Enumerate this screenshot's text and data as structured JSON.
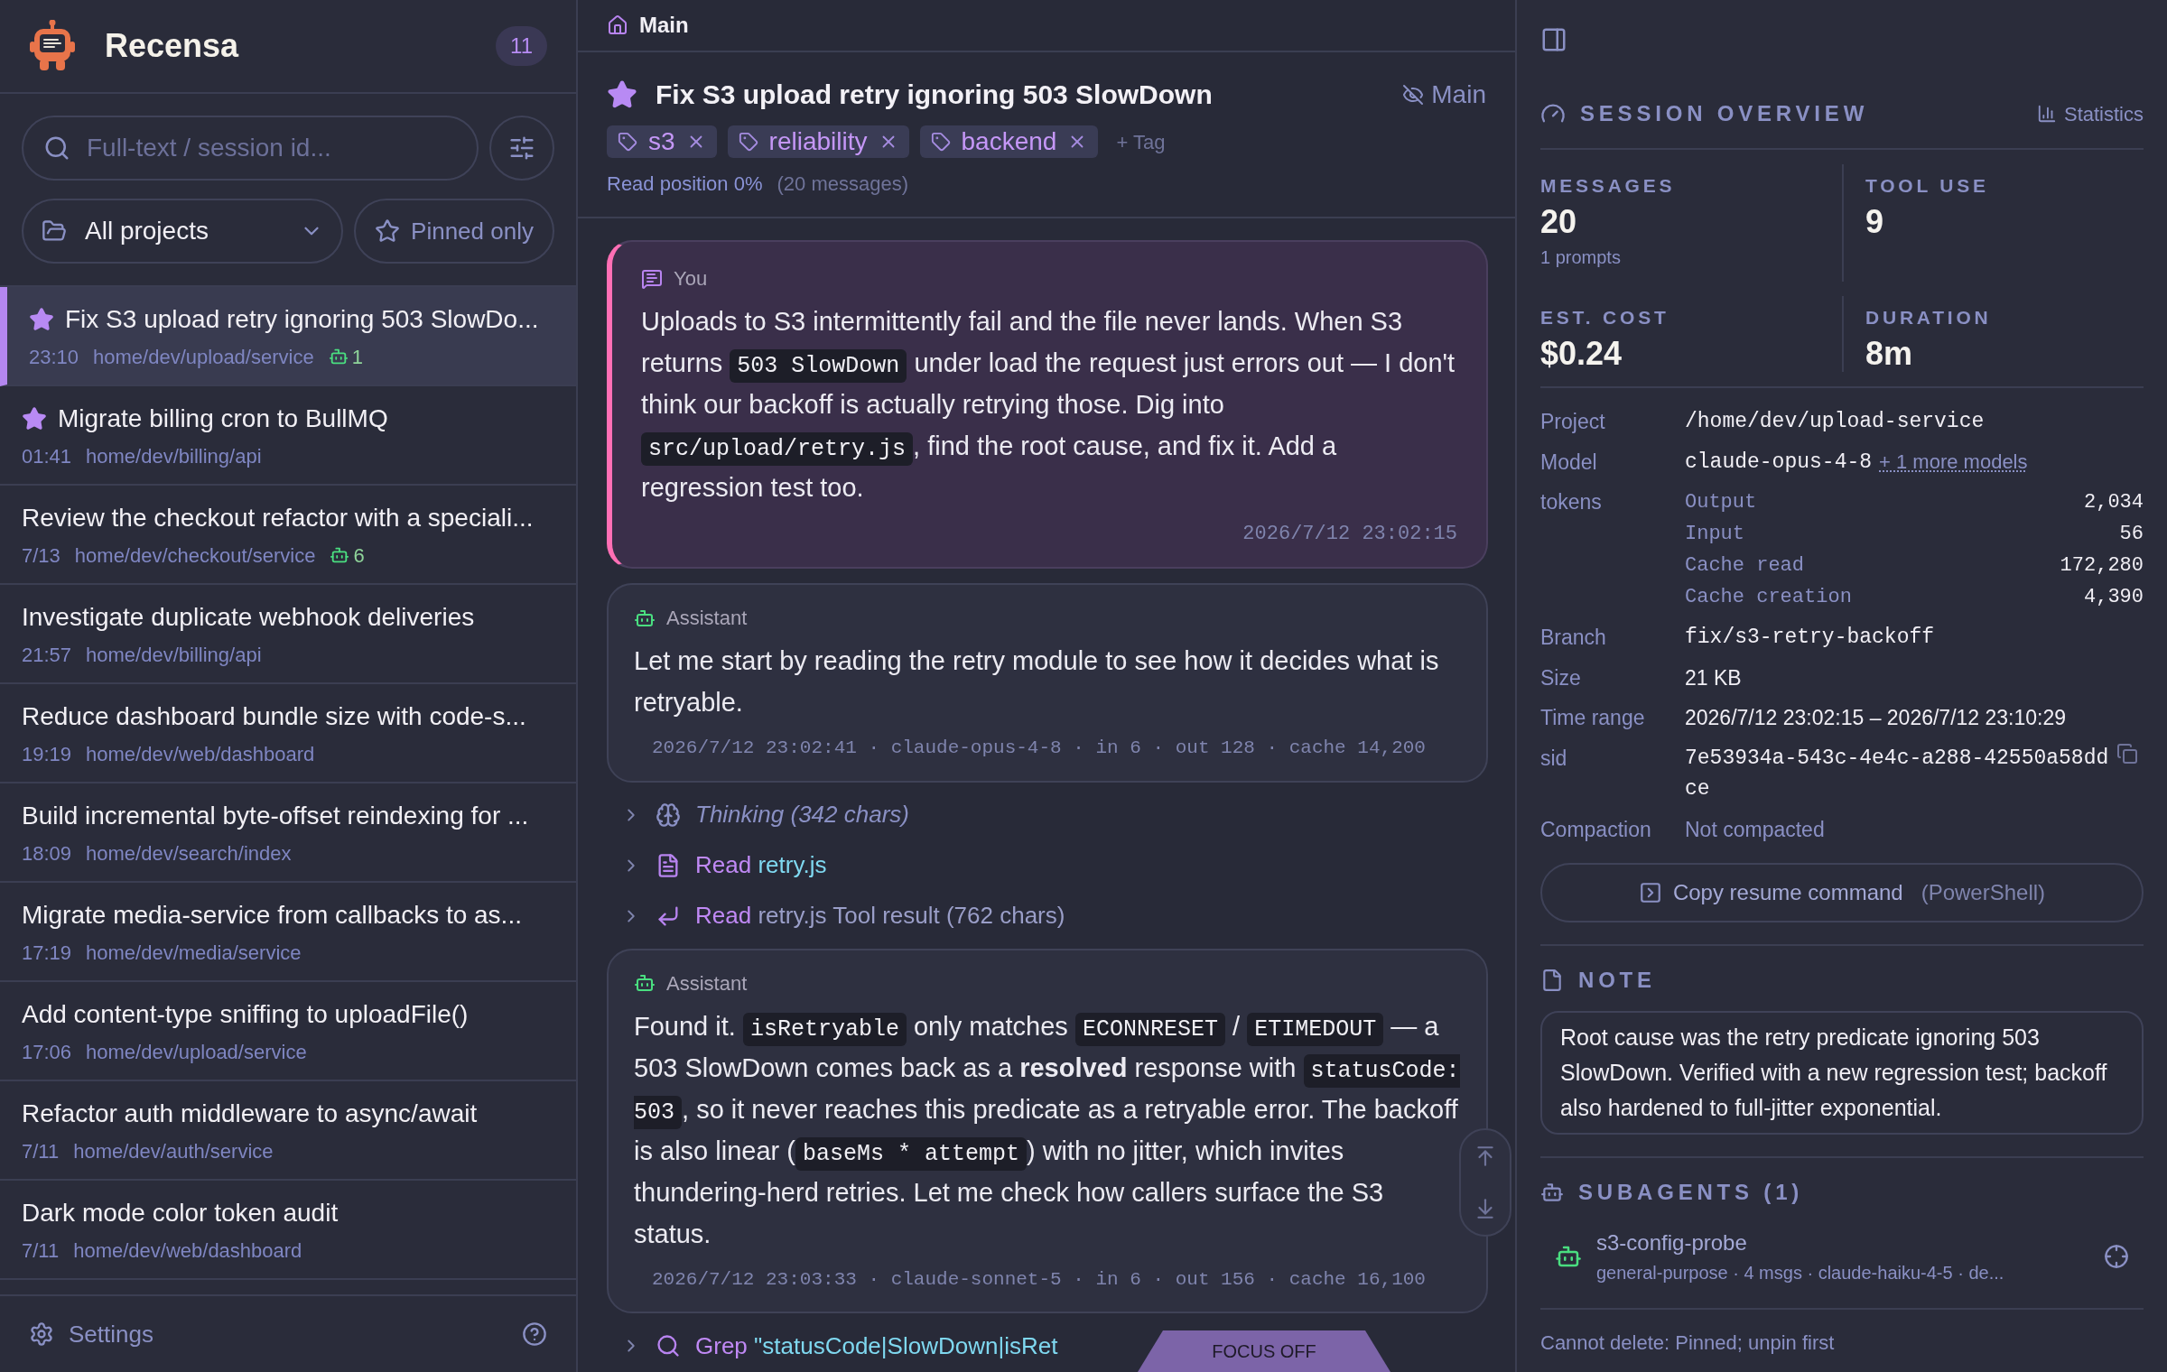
{
  "app": {
    "name": "Recensa",
    "count": "11"
  },
  "search": {
    "placeholder": "Full-text / session id..."
  },
  "project_filter": {
    "value": "All projects"
  },
  "pinned_filter": {
    "label": "Pinned only"
  },
  "sessions": [
    {
      "title": "Fix S3 upload retry ignoring 503 SlowDo...",
      "time": "23:10",
      "path": "home/dev/upload/service",
      "subagents": "1",
      "pinned": true,
      "selected": true
    },
    {
      "title": "Migrate billing cron to BullMQ",
      "time": "01:41",
      "path": "home/dev/billing/api",
      "pinned": true,
      "selected": false
    },
    {
      "title": "Review the checkout refactor with a speciali...",
      "time": "7/13",
      "path": "home/dev/checkout/service",
      "subagents": "6",
      "pinned": false,
      "selected": false
    },
    {
      "title": "Investigate duplicate webhook deliveries",
      "time": "21:57",
      "path": "home/dev/billing/api",
      "pinned": false,
      "selected": false
    },
    {
      "title": "Reduce dashboard bundle size with code-s...",
      "time": "19:19",
      "path": "home/dev/web/dashboard",
      "pinned": false,
      "selected": false
    },
    {
      "title": "Build incremental byte-offset reindexing for ...",
      "time": "18:09",
      "path": "home/dev/search/index",
      "pinned": false,
      "selected": false
    },
    {
      "title": "Migrate media-service from callbacks to as...",
      "time": "17:19",
      "path": "home/dev/media/service",
      "pinned": false,
      "selected": false
    },
    {
      "title": "Add content-type sniffing to uploadFile()",
      "time": "17:06",
      "path": "home/dev/upload/service",
      "pinned": false,
      "selected": false
    },
    {
      "title": "Refactor auth middleware to async/await",
      "time": "7/11",
      "path": "home/dev/auth/service",
      "pinned": false,
      "selected": false
    },
    {
      "title": "Dark mode color token audit",
      "time": "7/11",
      "path": "home/dev/web/dashboard",
      "pinned": false,
      "selected": false
    }
  ],
  "settings": {
    "label": "Settings"
  },
  "breadcrumb": "Main",
  "session": {
    "title": "Fix S3 upload retry ignoring 503 SlowDown",
    "pinned": true,
    "branch": "Main",
    "tags": [
      "s3",
      "reliability",
      "backend"
    ],
    "add_tag": "+ Tag",
    "read_position": "Read position",
    "read_percent": "0%",
    "message_count": "(20 messages)"
  },
  "messages": [
    {
      "kind": "user",
      "author": "You",
      "parts": [
        {
          "kind": "text",
          "text": "Uploads to S3 intermittently fail and the file never lands. When S3 returns "
        },
        {
          "kind": "code",
          "text": "503 SlowDown"
        },
        {
          "kind": "text",
          "text": " under load the request just errors out — I don't think our backoff is actually retrying those. Dig into "
        },
        {
          "kind": "code",
          "text": "src/upload/retry.js"
        },
        {
          "kind": "text",
          "text": ", find the root cause, and fix it. Add a regression test too."
        }
      ],
      "footer": "2026/7/12 23:02:15"
    },
    {
      "kind": "assistant",
      "author": "Assistant",
      "parts": [
        {
          "kind": "text",
          "text": "Let me start by reading the retry module to see how it decides what is retryable."
        }
      ],
      "footer": "2026/7/12 23:02:41 · claude-opus-4-8 · in 6 · out 128 · cache 14,200"
    },
    {
      "kind": "thinking",
      "label": "Thinking (342 chars)"
    },
    {
      "kind": "read",
      "verb": "Read",
      "target": "retry.js"
    },
    {
      "kind": "result",
      "verb": "Read",
      "target": "retry.js Tool result (762 chars)"
    },
    {
      "kind": "assistant",
      "author": "Assistant",
      "parts": [
        {
          "kind": "text",
          "text": "Found it. "
        },
        {
          "kind": "code",
          "text": "isRetryable"
        },
        {
          "kind": "text",
          "text": " only matches "
        },
        {
          "kind": "code",
          "text": "ECONNRESET"
        },
        {
          "kind": "text",
          "text": " / "
        },
        {
          "kind": "code",
          "text": "ETIMEDOUT"
        },
        {
          "kind": "text",
          "text": " — a 503 SlowDown comes back as a **resolved** response with "
        },
        {
          "kind": "code",
          "text": "statusCode: 503"
        },
        {
          "kind": "text",
          "text": ", so it never reaches this predicate as a retryable error. The backoff is also linear ("
        },
        {
          "kind": "code",
          "text": "baseMs * attempt"
        },
        {
          "kind": "text",
          "text": ") with no jitter, which invites thundering-herd retries. Let me check how callers surface the S3 status."
        }
      ],
      "footer": "2026/7/12 23:03:33 · claude-sonnet-5 · in 6 · out 156 · cache 16,100"
    },
    {
      "kind": "grep",
      "verb": "Grep",
      "target": "\"statusCode|SlowDown|isRet"
    }
  ],
  "focus_toggle": "FOCUS OFF",
  "overview": {
    "title": "SESSION OVERVIEW",
    "stats_link": "Statistics",
    "stats": [
      {
        "label": "MESSAGES",
        "value": "20",
        "sub": "1 prompts"
      },
      {
        "label": "TOOL USE",
        "value": "9"
      },
      {
        "label": "EST. COST",
        "value": "$0.24"
      },
      {
        "label": "DURATION",
        "value": "8m"
      }
    ],
    "details": [
      {
        "kind": "mono",
        "label": "Project",
        "value": "/home/dev/upload-service"
      },
      {
        "kind": "model",
        "label": "Model",
        "value": "claude-opus-4-8",
        "link": "+ 1 more models"
      },
      {
        "kind": "tokens",
        "label": "tokens",
        "tokens": [
          {
            "name": "Output",
            "value": "2,034"
          },
          {
            "name": "Input",
            "value": "56"
          },
          {
            "name": "Cache read",
            "value": "172,280"
          },
          {
            "name": "Cache creation",
            "value": "4,390"
          }
        ]
      },
      {
        "kind": "mono",
        "label": "Branch",
        "value": "fix/s3-retry-backoff"
      },
      {
        "kind": "text",
        "label": "Size",
        "value": "21 KB"
      },
      {
        "kind": "text",
        "label": "Time range",
        "value": "2026/7/12 23:02:15 – 2026/7/12 23:10:29"
      },
      {
        "kind": "sid",
        "label": "sid",
        "value": "7e53934a-543c-4e4c-a288-42550a58ddce"
      },
      {
        "kind": "muted",
        "label": "Compaction",
        "value": "Not compacted"
      }
    ],
    "resume_button": {
      "label": "Copy resume command",
      "shell": "(PowerShell)"
    }
  },
  "note": {
    "title": "NOTE",
    "text": "Root cause was the retry predicate ignoring 503 SlowDown. Verified with a new regression test; backoff also hardened to full-jitter exponential."
  },
  "subagents": {
    "title": "SUBAGENTS (1)",
    "items": [
      {
        "name": "s3-config-probe",
        "meta": "general-purpose · 4 msgs · claude-haiku-4-5 · de..."
      }
    ]
  },
  "footer_note": "Cannot delete: Pinned; unpin first"
}
